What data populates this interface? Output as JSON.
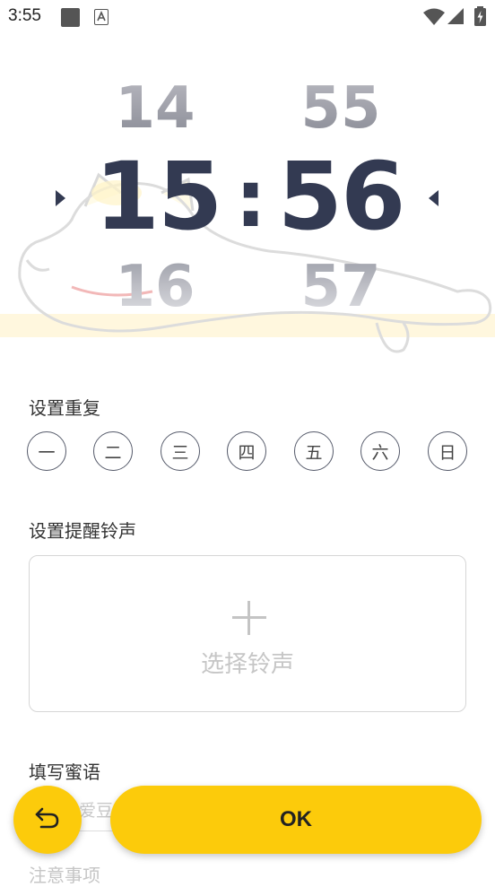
{
  "status_bar": {
    "time": "3:55",
    "icons": [
      "app-notification-icon",
      "a-notification-icon",
      "wifi-icon",
      "signal-icon",
      "battery-charging-icon"
    ]
  },
  "time_picker": {
    "hour_prev": "14",
    "hour_current": "15",
    "hour_next": "16",
    "minute_prev": "55",
    "minute_current": "56",
    "minute_next": "57",
    "separator": ":"
  },
  "repeat": {
    "title": "设置重复",
    "days": [
      "一",
      "二",
      "三",
      "四",
      "五",
      "六",
      "日"
    ]
  },
  "ringtone": {
    "title": "设置提醒铃声",
    "select_label": "选择铃声"
  },
  "message": {
    "title": "填写蜜语",
    "placeholder_partial": "爱豆"
  },
  "notes": {
    "title": "注意事项"
  },
  "actions": {
    "ok_label": "OK"
  },
  "colors": {
    "accent": "#fccb0b",
    "picker_text": "#333a52"
  }
}
